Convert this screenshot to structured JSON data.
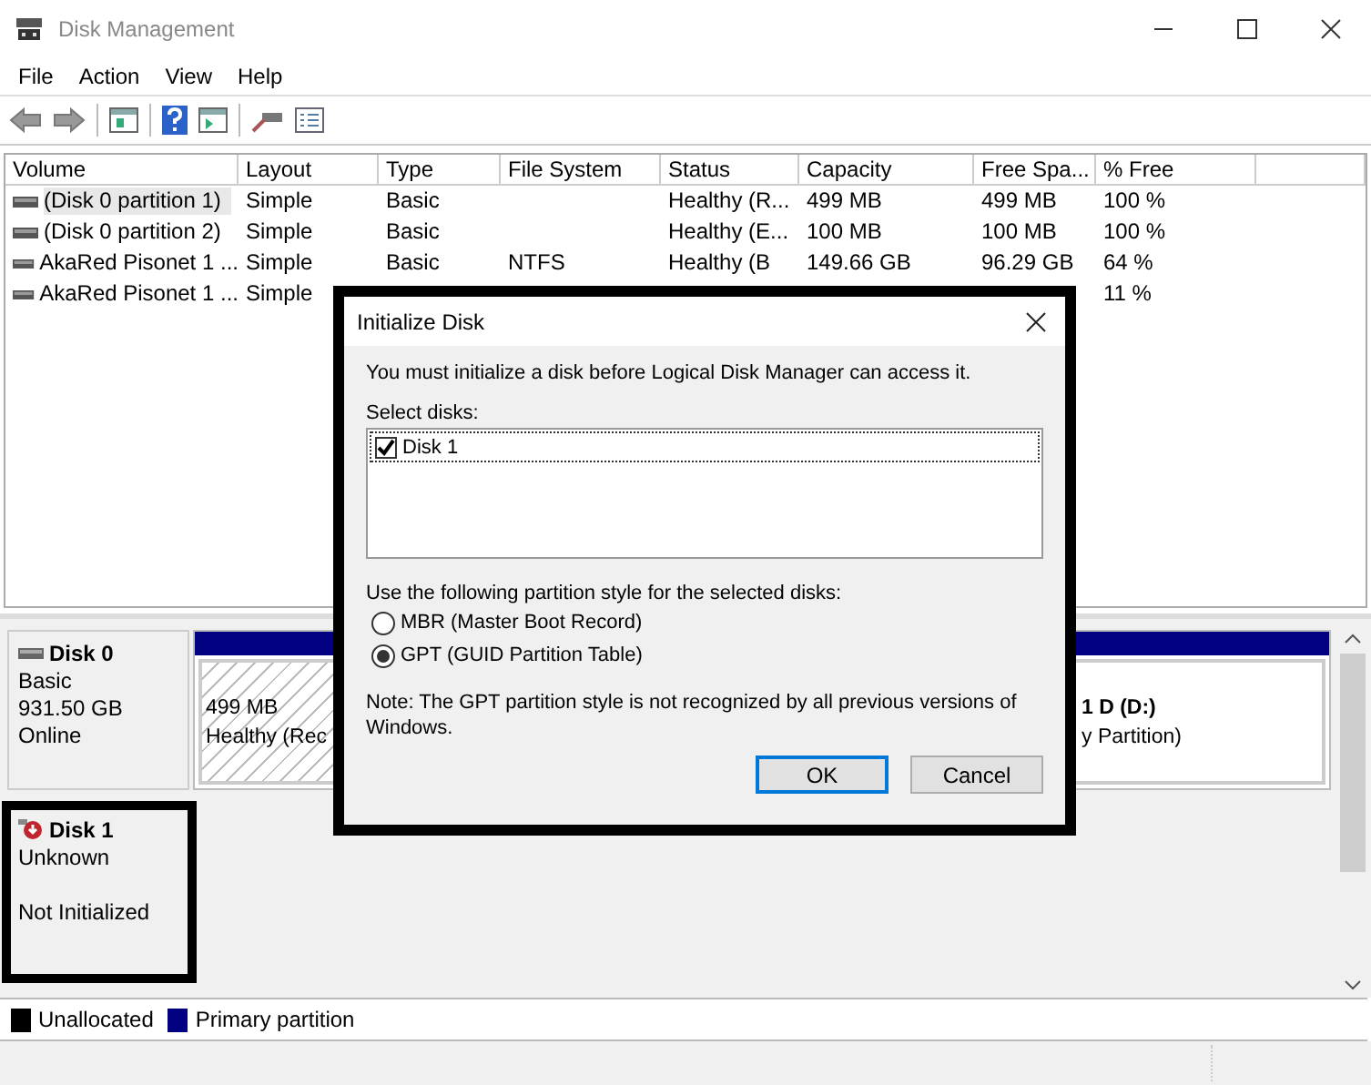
{
  "window": {
    "title": "Disk Management"
  },
  "menu": [
    "File",
    "Action",
    "View",
    "Help"
  ],
  "volumes": {
    "columns": [
      "Volume",
      "Layout",
      "Type",
      "File System",
      "Status",
      "Capacity",
      "Free Spa...",
      "% Free"
    ],
    "rows": [
      {
        "selected": true,
        "cells": [
          "(Disk 0 partition 1)",
          "Simple",
          "Basic",
          null,
          "Healthy (R...",
          "499 MB",
          "499 MB",
          "100 %"
        ]
      },
      {
        "selected": false,
        "cells": [
          "(Disk 0 partition 2)",
          "Simple",
          "Basic",
          null,
          "Healthy (E...",
          "100 MB",
          "100 MB",
          "100 %"
        ]
      },
      {
        "selected": false,
        "cells": [
          "AkaRed Pisonet 1 ...",
          "Simple",
          "Basic",
          "NTFS",
          "Healthy (B",
          "149.66 GB",
          "96.29 GB",
          "64 %"
        ]
      },
      {
        "selected": false,
        "cells": [
          "AkaRed Pisonet 1 ...",
          "Simple",
          null,
          null,
          null,
          null,
          null,
          "11 %"
        ]
      }
    ]
  },
  "disks": [
    {
      "name": "Disk 0",
      "kind": "online",
      "highlighted": false,
      "type": "Basic",
      "size": "931.50 GB",
      "status": "Online",
      "partitions": [
        {
          "kind": "recovery",
          "lines": [
            "499 MB",
            "Healthy (Rec"
          ]
        },
        {
          "kind": "primary",
          "lines": [
            "1 D  (D:)",
            "y Partition)"
          ]
        }
      ]
    },
    {
      "name": "Disk 1",
      "kind": "error",
      "highlighted": true,
      "type": "Unknown",
      "status": "Not Initialized"
    }
  ],
  "legend": [
    {
      "label": "Unallocated",
      "color": "#000000"
    },
    {
      "label": "Primary partition",
      "color": "#000080"
    }
  ],
  "dialog": {
    "title": "Initialize Disk",
    "highlighted": true,
    "message": "You must initialize a disk before Logical Disk Manager can access it.",
    "select_label": "Select disks:",
    "disks": [
      {
        "label": "Disk 1",
        "checked": true,
        "selected": true
      }
    ],
    "style_label": "Use the following partition style for the selected disks:",
    "styles": [
      {
        "label": "MBR (Master Boot Record)",
        "selected": false
      },
      {
        "label": "GPT (GUID Partition Table)",
        "selected": true
      }
    ],
    "note": "Note: The GPT partition style is not recognized by all previous versions of Windows.",
    "buttons": [
      {
        "label": "OK",
        "default": true
      },
      {
        "label": "Cancel",
        "default": false
      }
    ]
  }
}
